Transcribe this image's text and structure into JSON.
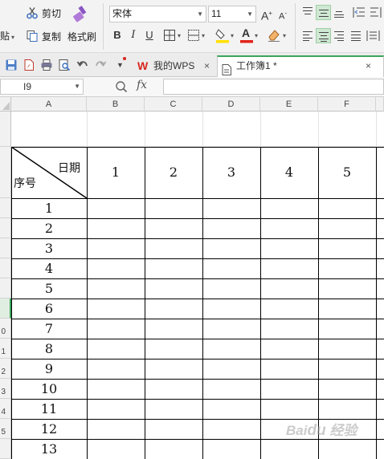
{
  "ribbon": {
    "paste_label": "粘贴",
    "cut_label": "剪切",
    "copy_label": "复制",
    "format_painter_label": "格式刷",
    "font_name": "宋体",
    "font_size": "11",
    "bold": "B",
    "italic": "I",
    "underline": "U",
    "increase_font": "A⁺",
    "decrease_font": "A⁻",
    "font_color_letter": "A",
    "highlight_color": "#ffe100",
    "font_color": "#e0241b"
  },
  "tabs": {
    "wps_label": "我的WPS",
    "workbook_label": "工作簿1 *",
    "close": "×"
  },
  "formula_bar": {
    "cell_ref": "I9",
    "fx": "fx",
    "zoom_glyph": "Q"
  },
  "columns": [
    "A",
    "B",
    "C",
    "D",
    "E",
    "F"
  ],
  "row_numbers": [
    "",
    "",
    "",
    "",
    "",
    "",
    "",
    "",
    "0",
    "1",
    "2",
    "3",
    "4",
    "5"
  ],
  "table": {
    "date_label": "日期",
    "serial_label": "序号",
    "day_headers": [
      "1",
      "2",
      "3",
      "4",
      "5"
    ],
    "serials": [
      "1",
      "2",
      "3",
      "4",
      "5",
      "6",
      "7",
      "8",
      "9",
      "10",
      "11",
      "12",
      "13"
    ]
  },
  "selected_row": 7,
  "colors": {
    "accent_green": "#3aa55a",
    "wps_red": "#d7261e"
  }
}
